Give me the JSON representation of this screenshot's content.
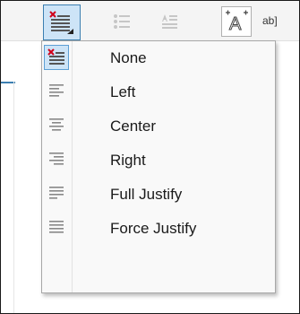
{
  "toolbar": {
    "abbr_text": "ab]"
  },
  "menu": {
    "items": [
      {
        "label": "None"
      },
      {
        "label": "Left"
      },
      {
        "label": "Center"
      },
      {
        "label": "Right"
      },
      {
        "label": "Full Justify"
      },
      {
        "label": "Force Justify"
      }
    ],
    "selected_item": "None"
  },
  "colors": {
    "accent": "#3c7fb1",
    "selected_bg": "#cde4f7",
    "remove_red": "#d0021b"
  },
  "icons": [
    "align-none-icon",
    "align-left-icon",
    "align-center-icon",
    "align-right-icon",
    "align-justify-icon",
    "align-force-justify-icon",
    "text-effect-icon",
    "bullets-icon"
  ]
}
